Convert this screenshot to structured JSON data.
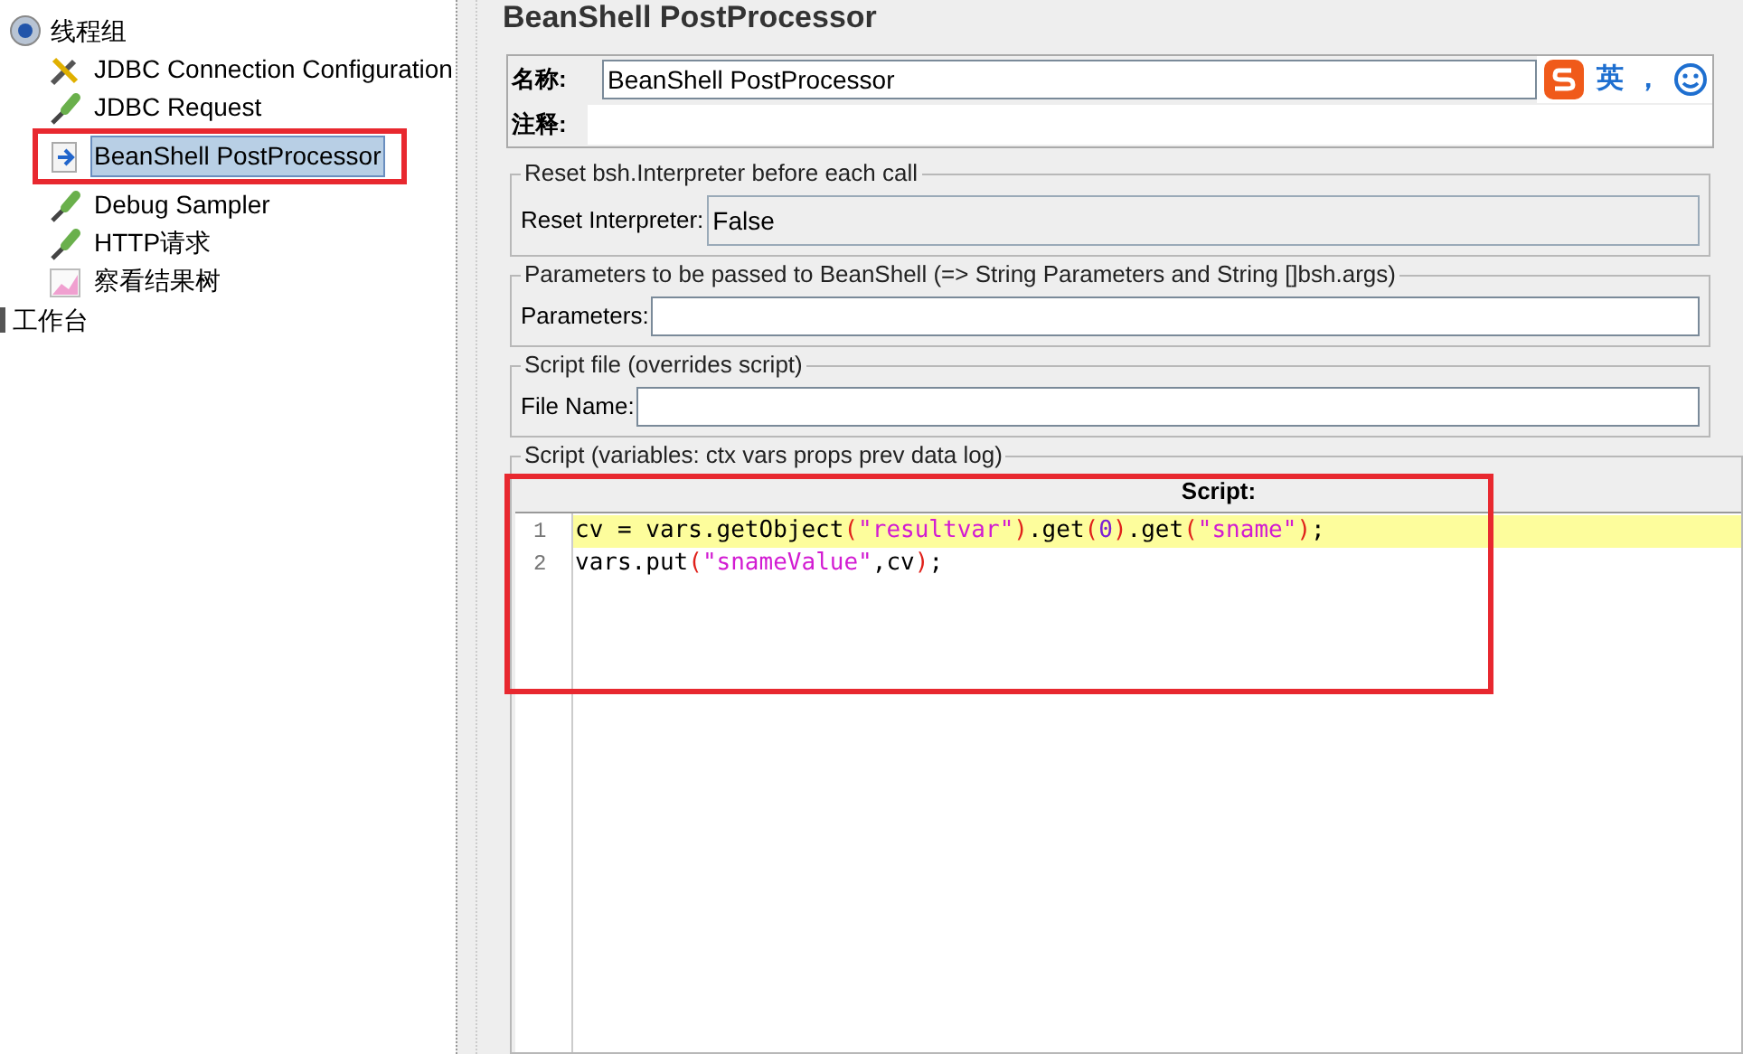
{
  "tree": {
    "root": {
      "label": "线程组",
      "expanded": true,
      "children": [
        {
          "label": "JDBC Connection Configuration",
          "kind": "config",
          "selected": false
        },
        {
          "label": "JDBC Request",
          "kind": "sampler",
          "selected": false
        },
        {
          "label": "BeanShell PostProcessor",
          "kind": "post",
          "selected": true
        },
        {
          "label": "Debug Sampler",
          "kind": "sampler",
          "selected": false
        },
        {
          "label": "HTTP请求",
          "kind": "sampler",
          "selected": false
        },
        {
          "label": "察看结果树",
          "kind": "listener",
          "selected": false
        }
      ]
    },
    "sibling": {
      "label": "工作台"
    }
  },
  "panel": {
    "title": "BeanShell PostProcessor",
    "name_label": "名称:",
    "name_value": "BeanShell PostProcessor",
    "comment_label": "注释:",
    "ime": {
      "lang": "英",
      "punct": "，"
    },
    "reset_group": {
      "title": "Reset bsh.Interpreter before each call",
      "label": "Reset Interpreter:",
      "value": "False"
    },
    "params_group": {
      "title": "Parameters to be passed to BeanShell (=> String Parameters and String []bsh.args)",
      "label": "Parameters:"
    },
    "file_group": {
      "title": "Script file (overrides script)",
      "label": "File Name:"
    },
    "script_group": {
      "title": "Script (variables: ctx vars props prev data log)",
      "header": "Script:",
      "lines": [
        {
          "number": "1",
          "selected": true,
          "tokens": [
            {
              "text": "cv = vars.getObject",
              "kind": "plain"
            },
            {
              "text": "(",
              "kind": "paren"
            },
            {
              "text": "\"resultvar\"",
              "kind": "string"
            },
            {
              "text": ")",
              "kind": "paren"
            },
            {
              "text": ".get",
              "kind": "plain"
            },
            {
              "text": "(",
              "kind": "paren"
            },
            {
              "text": "0",
              "kind": "number"
            },
            {
              "text": ")",
              "kind": "paren"
            },
            {
              "text": ".get",
              "kind": "plain"
            },
            {
              "text": "(",
              "kind": "paren"
            },
            {
              "text": "\"sname\"",
              "kind": "string"
            },
            {
              "text": ")",
              "kind": "paren"
            },
            {
              "text": ";",
              "kind": "plain"
            }
          ]
        },
        {
          "number": "2",
          "selected": false,
          "tokens": [
            {
              "text": "vars.put",
              "kind": "plain"
            },
            {
              "text": "(",
              "kind": "paren"
            },
            {
              "text": "\"snameValue\"",
              "kind": "string"
            },
            {
              "text": ",cv",
              "kind": "plain"
            },
            {
              "text": ")",
              "kind": "paren"
            },
            {
              "text": ";",
              "kind": "plain"
            }
          ]
        }
      ]
    }
  }
}
